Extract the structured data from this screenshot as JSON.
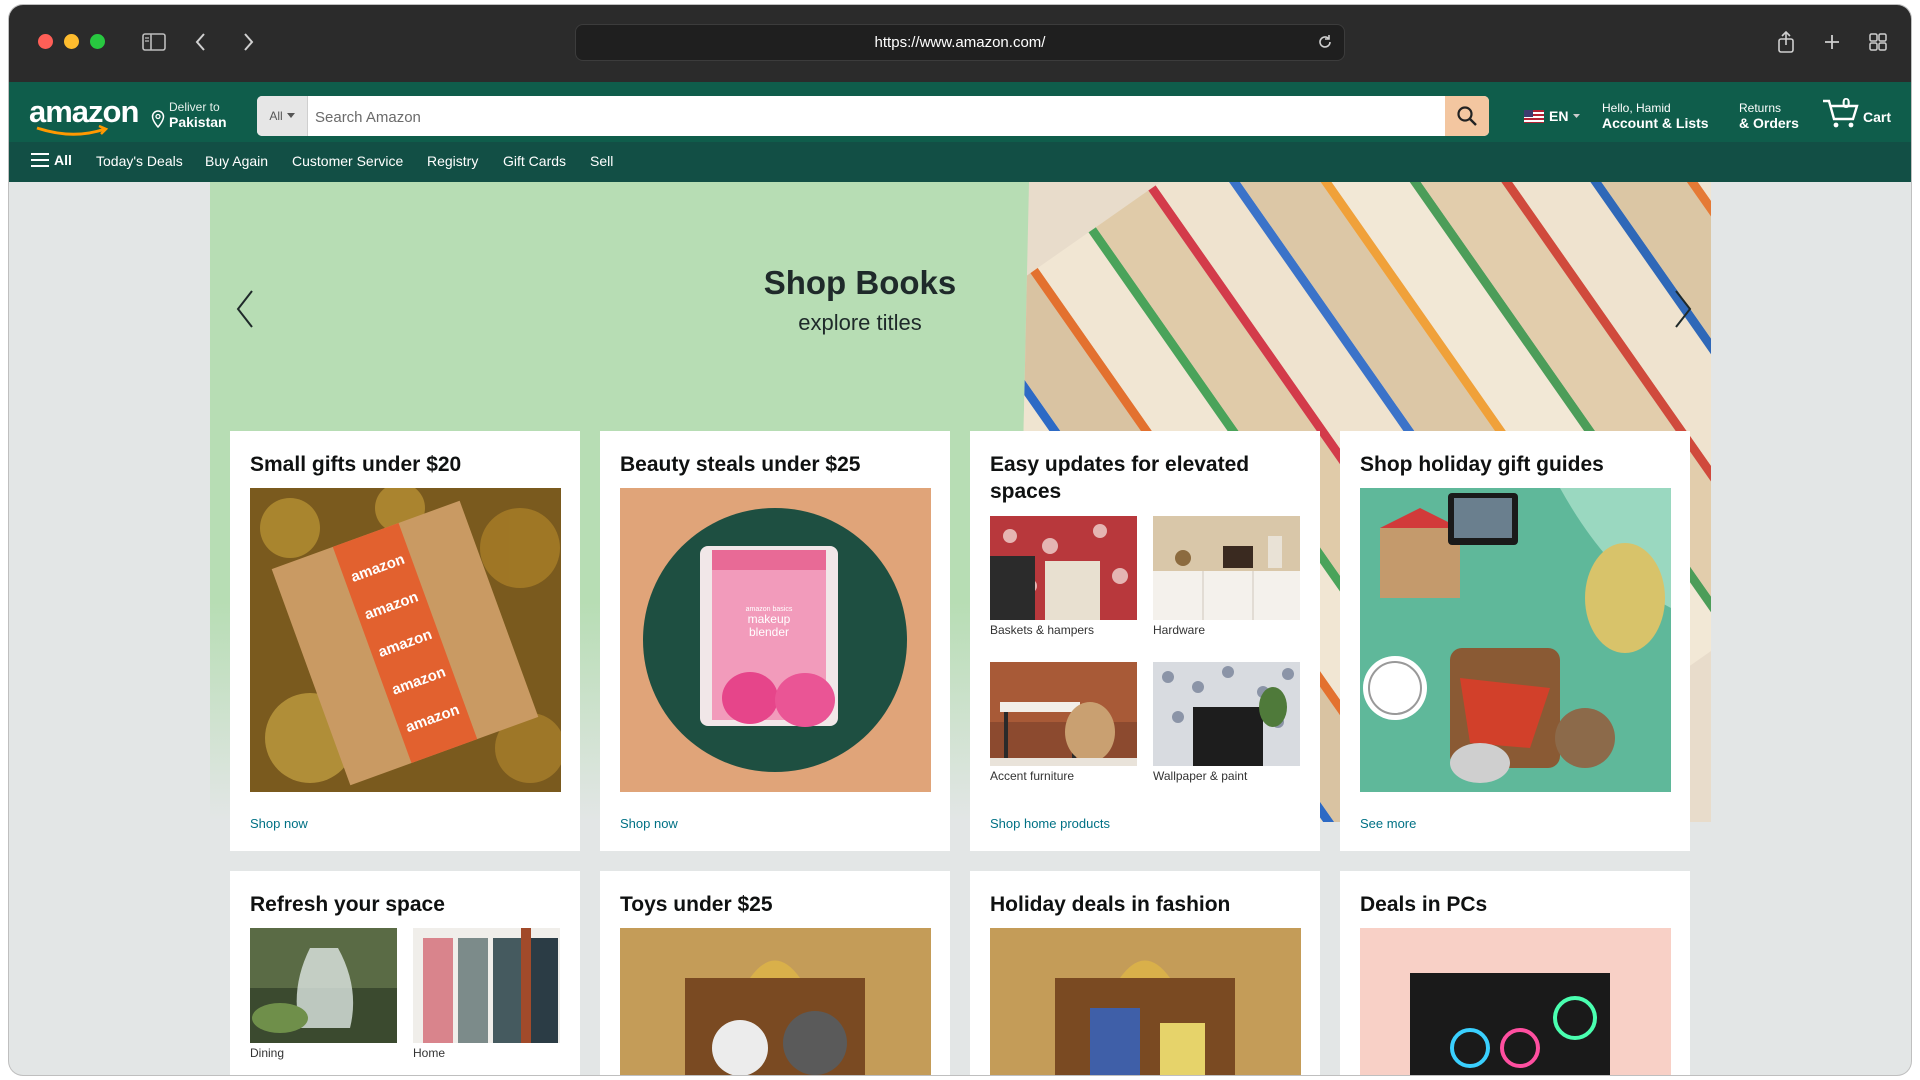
{
  "browser": {
    "url": "https://www.amazon.com/"
  },
  "header": {
    "logo": "amazon",
    "deliver_line1": "Deliver to",
    "deliver_line2": "Pakistan",
    "search_category": "All",
    "search_placeholder": "Search Amazon",
    "language": "EN",
    "account_line1": "Hello, Hamid",
    "account_line2": "Account & Lists",
    "orders_line1": "Returns",
    "orders_line2": "& Orders",
    "cart_count": "0",
    "cart_label": "Cart"
  },
  "nav": {
    "all_label": "All",
    "items": [
      "Today's Deals",
      "Buy Again",
      "Customer Service",
      "Registry",
      "Gift Cards",
      "Sell"
    ]
  },
  "hero": {
    "title": "Shop Books",
    "subtitle": "explore titles"
  },
  "cards": [
    {
      "title": "Small gifts under $20",
      "link": "Shop now"
    },
    {
      "title": "Beauty steals under $25",
      "link": "Shop now",
      "product_brand": "amazon basics",
      "product_line1": "makeup",
      "product_line2": "blender"
    },
    {
      "title": "Easy updates for elevated spaces",
      "link": "Shop home products",
      "tiles": [
        "Baskets & hampers",
        "Hardware",
        "Accent furniture",
        "Wallpaper & paint"
      ]
    },
    {
      "title": "Shop holiday gift guides",
      "link": "See more"
    },
    {
      "title": "Refresh your space",
      "tiles": [
        "Dining",
        "Home"
      ]
    },
    {
      "title": "Toys under $25"
    },
    {
      "title": "Holiday deals in fashion"
    },
    {
      "title": "Deals in PCs"
    }
  ],
  "colors": {
    "header_bg": "#0f5d4b",
    "nav_bg": "#124f45",
    "link": "#007185",
    "hero_bg": "#b7ddb4"
  }
}
